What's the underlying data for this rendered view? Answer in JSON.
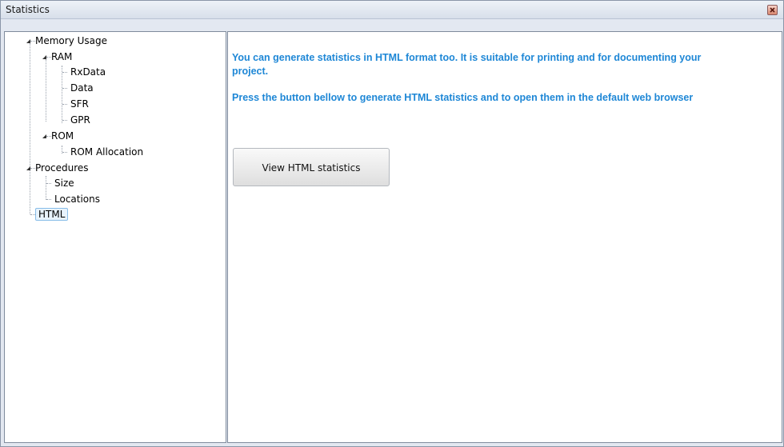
{
  "window": {
    "title": "Statistics"
  },
  "tree": {
    "memory_usage": "Memory Usage",
    "ram": "RAM",
    "rxdata": "RxData",
    "data": "Data",
    "sfr": "SFR",
    "gpr": "GPR",
    "rom": "ROM",
    "rom_allocation": "ROM Allocation",
    "procedures": "Procedures",
    "size": "Size",
    "locations": "Locations",
    "html": "HTML",
    "selected": "HTML"
  },
  "content": {
    "info_line1": "You can generate statistics in HTML format too. It is suitable for printing and for documenting your",
    "info_line2": "project.",
    "info_line3": "Press the button bellow to generate HTML statistics and to open them in the default web browser",
    "button_label": "View HTML statistics"
  },
  "colors": {
    "info_text": "#1e87d6",
    "selection_border": "#88bde8"
  },
  "icons": {
    "close": "close-icon",
    "expand": "expanded-arrow-icon"
  }
}
